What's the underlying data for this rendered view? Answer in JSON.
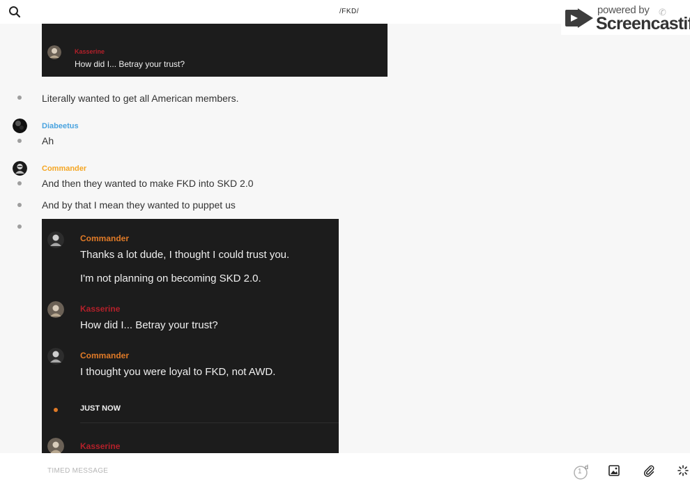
{
  "header": {
    "title": "/FKD/"
  },
  "watermark": {
    "top": "powered by",
    "brand": "Screencastify"
  },
  "screenshot1": {
    "name": "Kasserine",
    "text": "How did I... Betray your trust?"
  },
  "messages": [
    {
      "text": "Literally wanted to get all American members."
    },
    {
      "author": "Diabeetus",
      "text": "Ah"
    },
    {
      "author": "Commander",
      "text": "And then they wanted to make FKD into SKD 2.0"
    },
    {
      "text": "And by that I mean they wanted to puppet us"
    }
  ],
  "screenshot2": {
    "n1": "Commander",
    "t1a": "Thanks a lot dude, I thought I could trust you.",
    "t1b": "I'm not planning on becoming SKD 2.0.",
    "n2": "Kasserine",
    "t2": "How did I... Betray your trust?",
    "n3": "Commander",
    "t3": "I thought you were loyal to FKD, not AWD.",
    "status": "JUST NOW",
    "n4": "Kasserine"
  },
  "composer": {
    "placeholder": "TIMED MESSAGE",
    "timer_value": "1",
    "timer_unit": "d"
  },
  "colors": {
    "diabeetus": "#4aa3df",
    "commander": "#f5a623",
    "kasserine": "#b3202a",
    "orange": "#e07a27"
  }
}
